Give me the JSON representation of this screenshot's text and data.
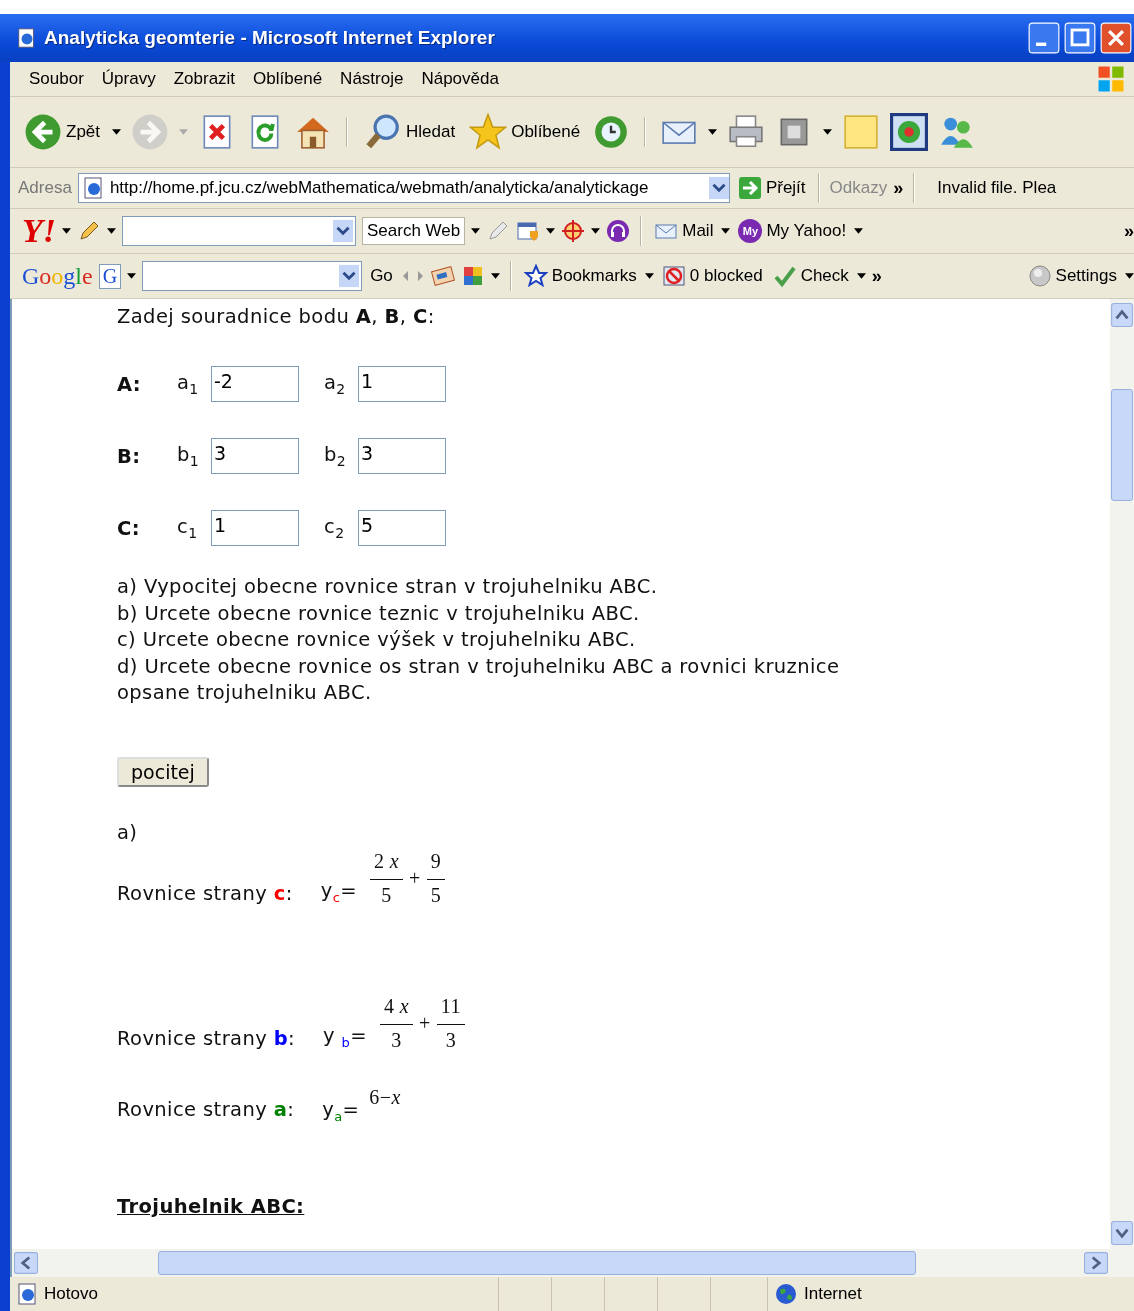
{
  "window": {
    "title": "Analyticka geomterie - Microsoft Internet Explorer"
  },
  "menu": {
    "items": [
      "Soubor",
      "Úpravy",
      "Zobrazit",
      "Oblíbené",
      "Nástroje",
      "Nápověda"
    ]
  },
  "toolbar": {
    "groups": [
      [
        {
          "kind": "back",
          "label": "Zpět",
          "caret": true
        },
        {
          "kind": "forward",
          "caret": true,
          "disabled": true
        },
        {
          "kind": "stop"
        },
        {
          "kind": "refresh"
        },
        {
          "kind": "home"
        }
      ],
      [
        {
          "kind": "search",
          "label": "Hledat"
        },
        {
          "kind": "favorites",
          "label": "Oblíbené"
        },
        {
          "kind": "history"
        }
      ],
      [
        {
          "kind": "mail",
          "caret": true
        },
        {
          "kind": "print"
        },
        {
          "kind": "window",
          "caret": true
        },
        {
          "kind": "note"
        },
        {
          "kind": "flower"
        },
        {
          "kind": "people"
        }
      ]
    ]
  },
  "address_bar": {
    "label": "Adresa",
    "url": "http://home.pf.jcu.cz/webMathematica/webmath/analyticka/analytickage",
    "go": "Přejít",
    "links": "Odkazy",
    "more": "»",
    "extra": "Invalid file. Plea"
  },
  "yahoo_toolbar": {
    "groups": [
      [
        {
          "kind": "logo",
          "label": "Y!",
          "caret": true
        },
        {
          "kind": "pencil",
          "caret": true
        },
        {
          "kind": "field",
          "dropdown": true
        },
        {
          "kind": "text",
          "label": "Search Web",
          "caret": true
        },
        {
          "kind": "highlighter"
        },
        {
          "kind": "calendar",
          "caret": true
        },
        {
          "kind": "target",
          "caret": true
        },
        {
          "kind": "headphones"
        }
      ],
      [
        {
          "kind": "mail",
          "label": "Mail",
          "caret": true
        },
        {
          "kind": "myyahoo",
          "badge": "My",
          "label": "My Yahoo!",
          "caret": true
        }
      ]
    ],
    "end": [
      {
        "kind": "more",
        "label": "»"
      }
    ]
  },
  "google_toolbar": {
    "groups": [
      [
        {
          "kind": "logo",
          "label": "Google"
        },
        {
          "kind": "gbox",
          "label": "G",
          "caret": true
        },
        {
          "kind": "field",
          "dropdown": true
        },
        {
          "kind": "text",
          "label": "Go"
        },
        {
          "kind": "arrows"
        },
        {
          "kind": "news"
        },
        {
          "kind": "puzzle",
          "caret": true
        }
      ],
      [
        {
          "kind": "bookmark",
          "label": "Bookmarks",
          "caret": true
        },
        {
          "kind": "blocked",
          "label": "0 blocked"
        },
        {
          "kind": "check",
          "label": "Check",
          "caret": true
        },
        {
          "kind": "more",
          "label": "»"
        }
      ]
    ],
    "end": [
      {
        "kind": "settings",
        "label": "Settings",
        "caret": true
      }
    ]
  },
  "content": {
    "intro": "Zadej souradnice bodu **A**, **B**, **C**:",
    "points": [
      {
        "label": "A:",
        "fields": [
          {
            "name": "a$_{1}$",
            "value": "-2"
          },
          {
            "name": "a$_{2}$",
            "value": "1"
          }
        ]
      },
      {
        "label": "B:",
        "fields": [
          {
            "name": "b$_{1}$",
            "value": "3"
          },
          {
            "name": "b$_{2}$",
            "value": "3"
          }
        ]
      },
      {
        "label": "C:",
        "fields": [
          {
            "name": "c$_{1}$",
            "value": "1"
          },
          {
            "name": "c$_{2}$",
            "value": "5"
          }
        ]
      }
    ],
    "tasks": "a) Vypocitej obecne rovnice stran v trojuhelniku ABC.\nb) Urcete obecne rovnice teznic v trojuhelniku ABC.\nc) Urcete obecne rovnice výšek v trojuhelniku ABC.\nd) Urcete obecne rovnice os stran v trojuhelniku ABC a rovnici kruznice opsane trojuhelniku ABC.",
    "button": "pocitej",
    "result_heading": "a)",
    "equations": [
      {
        "label": "Rovnice strany **c**:",
        "lhs": "y$_{c}$=",
        "color": "#ff0000",
        "formula": {
          "kind": "fractions",
          "terms": [
            {
              "num": "2 *x*",
              "den": "5"
            },
            {
              "num": "9",
              "den": "5"
            }
          ],
          "operator": "+"
        }
      },
      {
        "label": "Rovnice strany **b**:",
        "lhs": "y $_{b}$=",
        "color": "#0000ff",
        "formula": {
          "kind": "fractions",
          "terms": [
            {
              "num": "4 *x*",
              "den": "3"
            },
            {
              "num": "11",
              "den": "3"
            }
          ],
          "operator": "+"
        }
      },
      {
        "label": "Rovnice strany **a**:",
        "lhs": "y$_{a}$=",
        "color": "#008000",
        "formula": {
          "kind": "plain",
          "text": "6−*x*"
        }
      }
    ],
    "section_heading": "Trojuhelnik ABC:"
  },
  "status_bar": {
    "text": "Hotovo",
    "zone": "Internet"
  }
}
